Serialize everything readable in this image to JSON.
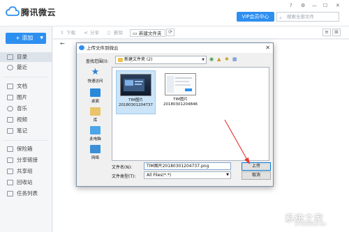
{
  "app": {
    "brand": "腾讯微云",
    "vip_button": "VIP会员中心",
    "search_placeholder": "搜索全部文件",
    "win_controls": [
      "?",
      "⚙",
      "—",
      "☐",
      "✕"
    ]
  },
  "sidebar": {
    "add_label": "+ 添加",
    "items": [
      {
        "label": "目录",
        "icon": "folder-icon"
      },
      {
        "label": "最近",
        "icon": "clock-icon"
      },
      {
        "label": "文档",
        "icon": "document-icon"
      },
      {
        "label": "图片",
        "icon": "image-icon"
      },
      {
        "label": "音乐",
        "icon": "music-icon"
      },
      {
        "label": "视频",
        "icon": "video-icon"
      },
      {
        "label": "笔记",
        "icon": "note-icon"
      },
      {
        "label": "保险箱",
        "icon": "safe-icon"
      },
      {
        "label": "分享链接",
        "icon": "share-link-icon"
      },
      {
        "label": "共享组",
        "icon": "group-icon"
      },
      {
        "label": "回收站",
        "icon": "trash-icon"
      },
      {
        "label": "任务列表",
        "icon": "task-list-icon"
      }
    ]
  },
  "toolbar": {
    "download": "下载",
    "share": "分享",
    "delete": "删除",
    "new_folder": "新建文件夹",
    "refresh_icon": "⟳"
  },
  "dialog": {
    "title": "上传文件到微云",
    "lookin_label": "查找范围(I):",
    "lookin_value": "新建文件夹 (2)",
    "places": [
      "快速访问",
      "桌面",
      "库",
      "此电脑",
      "网络"
    ],
    "files": [
      {
        "name": "TIM图片",
        "stamp": "20180301204737",
        "selected": true
      },
      {
        "name": "TIM图片",
        "stamp": "20180301204846",
        "selected": false
      }
    ],
    "filename_label": "文件名(N):",
    "filename_value": "TIM图片20180301204737.png",
    "filetype_label": "文件类型(T):",
    "filetype_value": "All Files(*.*)",
    "upload_button": "上传",
    "cancel_button": "取消"
  },
  "watermark": {
    "text": "系统之家",
    "sub": "XITONGZHIJIA.NET"
  },
  "colors": {
    "accent": "#2d8ff0",
    "arrow": "#e53935"
  }
}
